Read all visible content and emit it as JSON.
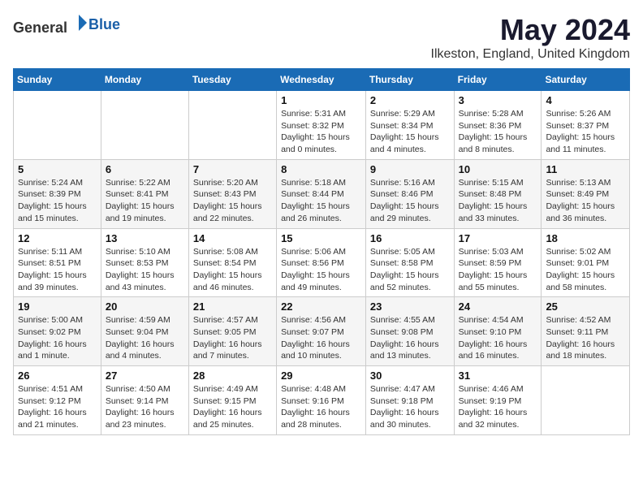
{
  "logo": {
    "general": "General",
    "blue": "Blue"
  },
  "header": {
    "month": "May 2024",
    "location": "Ilkeston, England, United Kingdom"
  },
  "weekdays": [
    "Sunday",
    "Monday",
    "Tuesday",
    "Wednesday",
    "Thursday",
    "Friday",
    "Saturday"
  ],
  "weeks": [
    [
      {
        "day": "",
        "info": ""
      },
      {
        "day": "",
        "info": ""
      },
      {
        "day": "",
        "info": ""
      },
      {
        "day": "1",
        "info": "Sunrise: 5:31 AM\nSunset: 8:32 PM\nDaylight: 15 hours\nand 0 minutes."
      },
      {
        "day": "2",
        "info": "Sunrise: 5:29 AM\nSunset: 8:34 PM\nDaylight: 15 hours\nand 4 minutes."
      },
      {
        "day": "3",
        "info": "Sunrise: 5:28 AM\nSunset: 8:36 PM\nDaylight: 15 hours\nand 8 minutes."
      },
      {
        "day": "4",
        "info": "Sunrise: 5:26 AM\nSunset: 8:37 PM\nDaylight: 15 hours\nand 11 minutes."
      }
    ],
    [
      {
        "day": "5",
        "info": "Sunrise: 5:24 AM\nSunset: 8:39 PM\nDaylight: 15 hours\nand 15 minutes."
      },
      {
        "day": "6",
        "info": "Sunrise: 5:22 AM\nSunset: 8:41 PM\nDaylight: 15 hours\nand 19 minutes."
      },
      {
        "day": "7",
        "info": "Sunrise: 5:20 AM\nSunset: 8:43 PM\nDaylight: 15 hours\nand 22 minutes."
      },
      {
        "day": "8",
        "info": "Sunrise: 5:18 AM\nSunset: 8:44 PM\nDaylight: 15 hours\nand 26 minutes."
      },
      {
        "day": "9",
        "info": "Sunrise: 5:16 AM\nSunset: 8:46 PM\nDaylight: 15 hours\nand 29 minutes."
      },
      {
        "day": "10",
        "info": "Sunrise: 5:15 AM\nSunset: 8:48 PM\nDaylight: 15 hours\nand 33 minutes."
      },
      {
        "day": "11",
        "info": "Sunrise: 5:13 AM\nSunset: 8:49 PM\nDaylight: 15 hours\nand 36 minutes."
      }
    ],
    [
      {
        "day": "12",
        "info": "Sunrise: 5:11 AM\nSunset: 8:51 PM\nDaylight: 15 hours\nand 39 minutes."
      },
      {
        "day": "13",
        "info": "Sunrise: 5:10 AM\nSunset: 8:53 PM\nDaylight: 15 hours\nand 43 minutes."
      },
      {
        "day": "14",
        "info": "Sunrise: 5:08 AM\nSunset: 8:54 PM\nDaylight: 15 hours\nand 46 minutes."
      },
      {
        "day": "15",
        "info": "Sunrise: 5:06 AM\nSunset: 8:56 PM\nDaylight: 15 hours\nand 49 minutes."
      },
      {
        "day": "16",
        "info": "Sunrise: 5:05 AM\nSunset: 8:58 PM\nDaylight: 15 hours\nand 52 minutes."
      },
      {
        "day": "17",
        "info": "Sunrise: 5:03 AM\nSunset: 8:59 PM\nDaylight: 15 hours\nand 55 minutes."
      },
      {
        "day": "18",
        "info": "Sunrise: 5:02 AM\nSunset: 9:01 PM\nDaylight: 15 hours\nand 58 minutes."
      }
    ],
    [
      {
        "day": "19",
        "info": "Sunrise: 5:00 AM\nSunset: 9:02 PM\nDaylight: 16 hours\nand 1 minute."
      },
      {
        "day": "20",
        "info": "Sunrise: 4:59 AM\nSunset: 9:04 PM\nDaylight: 16 hours\nand 4 minutes."
      },
      {
        "day": "21",
        "info": "Sunrise: 4:57 AM\nSunset: 9:05 PM\nDaylight: 16 hours\nand 7 minutes."
      },
      {
        "day": "22",
        "info": "Sunrise: 4:56 AM\nSunset: 9:07 PM\nDaylight: 16 hours\nand 10 minutes."
      },
      {
        "day": "23",
        "info": "Sunrise: 4:55 AM\nSunset: 9:08 PM\nDaylight: 16 hours\nand 13 minutes."
      },
      {
        "day": "24",
        "info": "Sunrise: 4:54 AM\nSunset: 9:10 PM\nDaylight: 16 hours\nand 16 minutes."
      },
      {
        "day": "25",
        "info": "Sunrise: 4:52 AM\nSunset: 9:11 PM\nDaylight: 16 hours\nand 18 minutes."
      }
    ],
    [
      {
        "day": "26",
        "info": "Sunrise: 4:51 AM\nSunset: 9:12 PM\nDaylight: 16 hours\nand 21 minutes."
      },
      {
        "day": "27",
        "info": "Sunrise: 4:50 AM\nSunset: 9:14 PM\nDaylight: 16 hours\nand 23 minutes."
      },
      {
        "day": "28",
        "info": "Sunrise: 4:49 AM\nSunset: 9:15 PM\nDaylight: 16 hours\nand 25 minutes."
      },
      {
        "day": "29",
        "info": "Sunrise: 4:48 AM\nSunset: 9:16 PM\nDaylight: 16 hours\nand 28 minutes."
      },
      {
        "day": "30",
        "info": "Sunrise: 4:47 AM\nSunset: 9:18 PM\nDaylight: 16 hours\nand 30 minutes."
      },
      {
        "day": "31",
        "info": "Sunrise: 4:46 AM\nSunset: 9:19 PM\nDaylight: 16 hours\nand 32 minutes."
      },
      {
        "day": "",
        "info": ""
      }
    ]
  ]
}
